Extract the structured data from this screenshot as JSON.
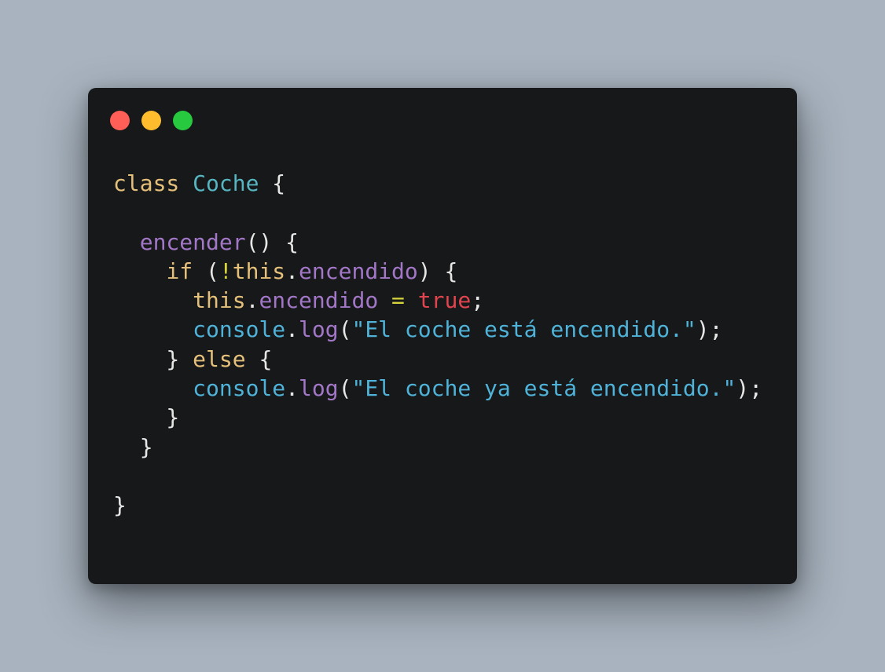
{
  "window": {
    "controls": [
      {
        "name": "close",
        "color": "#ff5f56"
      },
      {
        "name": "minimize",
        "color": "#ffbd2e"
      },
      {
        "name": "maximize",
        "color": "#27c93f"
      }
    ]
  },
  "code": {
    "language": "javascript",
    "lines": [
      [
        {
          "t": "class",
          "k": "keyword"
        },
        {
          "t": " ",
          "k": "punc"
        },
        {
          "t": "Coche",
          "k": "class"
        },
        {
          "t": " {",
          "k": "punc"
        }
      ],
      [],
      [
        {
          "t": "  ",
          "k": "punc"
        },
        {
          "t": "encender",
          "k": "method"
        },
        {
          "t": "() {",
          "k": "punc"
        }
      ],
      [
        {
          "t": "    ",
          "k": "punc"
        },
        {
          "t": "if",
          "k": "keyword"
        },
        {
          "t": " (",
          "k": "punc"
        },
        {
          "t": "!",
          "k": "op"
        },
        {
          "t": "this",
          "k": "this"
        },
        {
          "t": ".",
          "k": "punc"
        },
        {
          "t": "encendido",
          "k": "prop"
        },
        {
          "t": ") {",
          "k": "punc"
        }
      ],
      [
        {
          "t": "      ",
          "k": "punc"
        },
        {
          "t": "this",
          "k": "this"
        },
        {
          "t": ".",
          "k": "punc"
        },
        {
          "t": "encendido",
          "k": "prop"
        },
        {
          "t": " ",
          "k": "punc"
        },
        {
          "t": "=",
          "k": "op"
        },
        {
          "t": " ",
          "k": "punc"
        },
        {
          "t": "true",
          "k": "bool"
        },
        {
          "t": ";",
          "k": "punc"
        }
      ],
      [
        {
          "t": "      ",
          "k": "punc"
        },
        {
          "t": "console",
          "k": "obj"
        },
        {
          "t": ".",
          "k": "punc"
        },
        {
          "t": "log",
          "k": "method"
        },
        {
          "t": "(",
          "k": "punc"
        },
        {
          "t": "\"El coche está encendido.\"",
          "k": "str"
        },
        {
          "t": ");",
          "k": "punc"
        }
      ],
      [
        {
          "t": "    } ",
          "k": "punc"
        },
        {
          "t": "else",
          "k": "keyword"
        },
        {
          "t": " {",
          "k": "punc"
        }
      ],
      [
        {
          "t": "      ",
          "k": "punc"
        },
        {
          "t": "console",
          "k": "obj"
        },
        {
          "t": ".",
          "k": "punc"
        },
        {
          "t": "log",
          "k": "method"
        },
        {
          "t": "(",
          "k": "punc"
        },
        {
          "t": "\"El coche ya está encendido.\"",
          "k": "str"
        },
        {
          "t": ");",
          "k": "punc"
        }
      ],
      [
        {
          "t": "    }",
          "k": "punc"
        }
      ],
      [
        {
          "t": "  }",
          "k": "punc"
        }
      ],
      [],
      [
        {
          "t": "}",
          "k": "punc"
        }
      ]
    ]
  }
}
